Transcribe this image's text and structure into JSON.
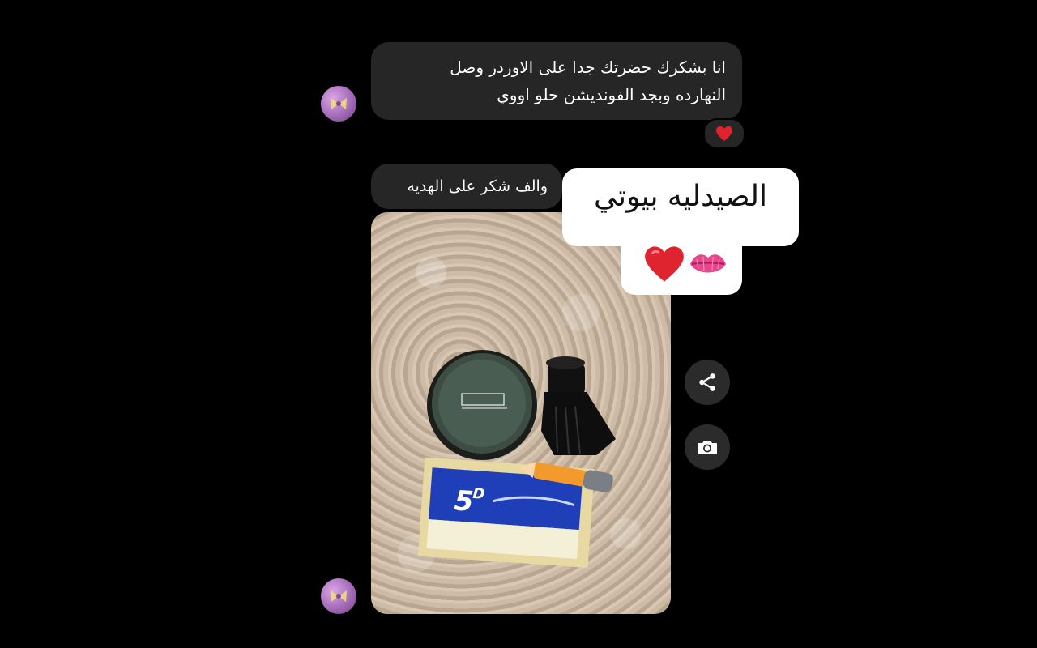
{
  "conversation": {
    "messages": [
      {
        "type": "text",
        "lines": [
          "انا بشكرك حضرتك جدا على الاوردر وصل",
          "النهارده وبجد الفونديشن حلو اووي"
        ],
        "reaction": "heart"
      },
      {
        "type": "text",
        "lines": [
          "والف شكر على الهديه"
        ]
      },
      {
        "type": "photo",
        "image_description_icon": "product-photo"
      }
    ]
  },
  "sticker": {
    "text": "الصيدليه  بيوتي",
    "emojis": [
      "kiss-lips",
      "red-heart"
    ]
  },
  "actions": {
    "share_icon": "share-icon",
    "camera_icon": "camera-icon"
  },
  "colors": {
    "background": "#000000",
    "bubble": "#262626",
    "text": "#ffffff",
    "heart": "#e0242f",
    "lips": "#e8458b"
  }
}
